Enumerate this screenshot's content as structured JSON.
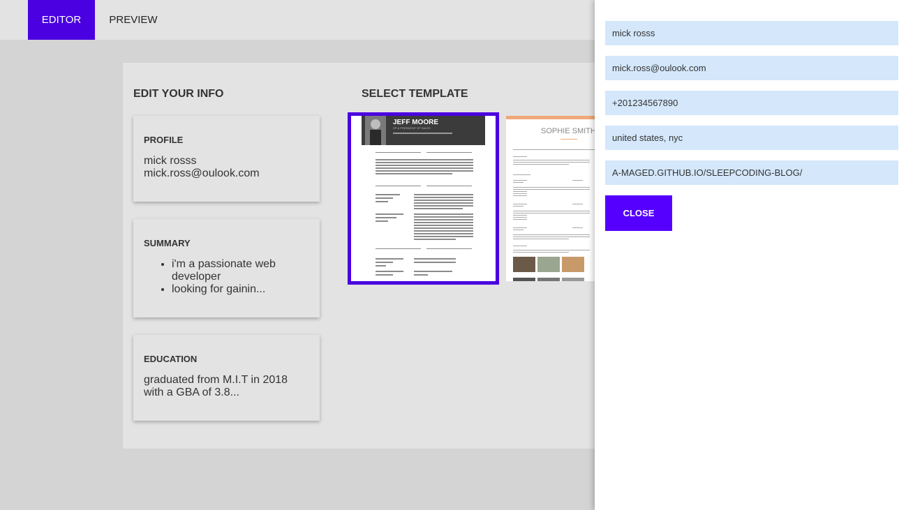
{
  "nav": {
    "editor_label": "EDITOR",
    "preview_label": "PREVIEW"
  },
  "editor": {
    "info_title": "EDIT YOUR INFO",
    "template_title": "SELECT TEMPLATE",
    "profile": {
      "heading": "PROFILE",
      "name": "mick rosss",
      "email": "mick.ross@oulook.com"
    },
    "summary": {
      "heading": "SUMMARY",
      "items": [
        "i'm a passionate web developer",
        "looking for gainin..."
      ]
    },
    "education": {
      "heading": "EDUCATION",
      "text": "graduated from M.I.T in 2018 with a GBA of 3.8..."
    }
  },
  "templates": [
    {
      "name": "JEFF MOORE",
      "subtitle": "VP & PRESIDENT OF SALES",
      "selected": true
    },
    {
      "name": "SOPHIE SMITH",
      "selected": false
    }
  ],
  "drawer": {
    "fields": {
      "name": "mick rosss",
      "email": "mick.ross@oulook.com",
      "phone": "+201234567890",
      "location": "united states, nyc",
      "website": "A-MAGED.GITHUB.IO/SLEEPCODING-BLOG/"
    },
    "close_label": "CLOSE"
  },
  "colors": {
    "accent": "#4a00e0",
    "close_button": "#5500ff",
    "field_bg": "#d4e7fb"
  }
}
